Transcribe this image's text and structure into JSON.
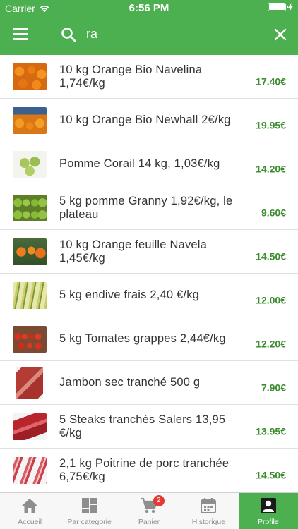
{
  "status_bar": {
    "carrier": "Carrier",
    "time": "6:56 PM",
    "battery_level": 1.0
  },
  "search": {
    "value": "ra",
    "icons": {
      "menu": "menu-icon",
      "search": "search-icon",
      "close": "close-icon"
    }
  },
  "products": [
    {
      "name": "10 kg Orange Bio  Navelina 1,74€/kg",
      "price": "17.40€",
      "thumb": "orange-crate"
    },
    {
      "name": "10 kg Orange Bio  Newhall  2€/kg",
      "price": "19.95€",
      "thumb": "orange-crate"
    },
    {
      "name": "Pomme Corail 14 kg, 1,03€/kg",
      "price": "14.20€",
      "thumb": "apples"
    },
    {
      "name": "5 kg pomme Granny 1,92€/kg, le plateau",
      "price": "9.60€",
      "thumb": "green-apples"
    },
    {
      "name": "10 kg Orange feuille Navela 1,45€/kg",
      "price": "14.50€",
      "thumb": "orange-leaf"
    },
    {
      "name": "5 kg endive frais 2,40 €/kg",
      "price": "12.00€",
      "thumb": "endives"
    },
    {
      "name": "5 kg Tomates grappes 2,44€/kg",
      "price": "12.20€",
      "thumb": "tomatoes"
    },
    {
      "name": "Jambon sec tranché 500 g",
      "price": "7.90€",
      "thumb": "ham"
    },
    {
      "name": "5 Steaks tranchés Salers 13,95 €/kg",
      "price": "13.95€",
      "thumb": "steaks"
    },
    {
      "name": "2,1 kg Poitrine de porc tranchée 6,75€/kg",
      "price": "14.50€",
      "thumb": "pork-belly"
    }
  ],
  "tabs": [
    {
      "label": "Accueil",
      "icon": "home-icon",
      "active": false
    },
    {
      "label": "Par categorie",
      "icon": "grid-icon",
      "active": false
    },
    {
      "label": "Panier",
      "icon": "cart-icon",
      "active": false,
      "badge": "2"
    },
    {
      "label": "Historique",
      "icon": "calendar-icon",
      "active": false
    },
    {
      "label": "Profile",
      "icon": "profile-icon",
      "active": true
    }
  ],
  "colors": {
    "primary": "#4caf50",
    "price": "#3c8d2f",
    "badge": "#e53935"
  }
}
